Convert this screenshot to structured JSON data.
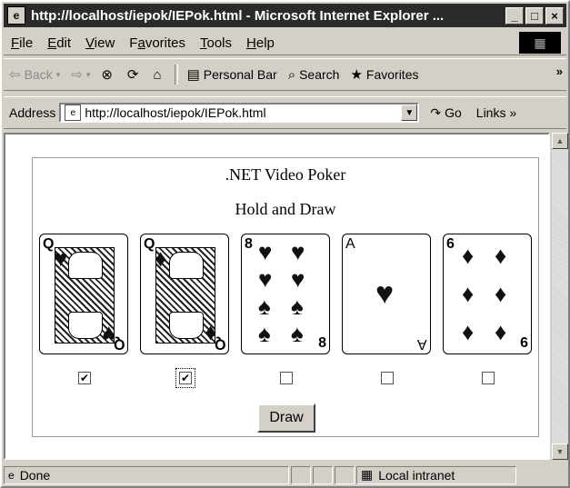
{
  "window": {
    "title": "http://localhost/iepok/IEPok.html - Microsoft Internet Explorer ...",
    "minimize": "_",
    "maximize": "□",
    "close": "×"
  },
  "menu": [
    {
      "pre": "",
      "u": "F",
      "post": "ile"
    },
    {
      "pre": "",
      "u": "E",
      "post": "dit"
    },
    {
      "pre": "",
      "u": "V",
      "post": "iew"
    },
    {
      "pre": "F",
      "u": "a",
      "post": "vorites"
    },
    {
      "pre": "",
      "u": "T",
      "post": "ools"
    },
    {
      "pre": "",
      "u": "H",
      "post": "elp"
    }
  ],
  "toolbar": {
    "back": "Back",
    "personal_bar": "Personal Bar",
    "search": "Search",
    "favorites": "Favorites"
  },
  "address": {
    "label": "Address",
    "url": "http://localhost/iepok/IEPok.html",
    "go": "Go",
    "links": "Links"
  },
  "page": {
    "title": ".NET Video Poker",
    "subtitle": "Hold and Draw",
    "cards": [
      {
        "rank": "Q",
        "suit": "♥",
        "type": "face",
        "held": true
      },
      {
        "rank": "Q",
        "suit": "♦",
        "type": "face",
        "held": true
      },
      {
        "rank": "8",
        "suit": "♥♠",
        "type": "pips",
        "held": false
      },
      {
        "rank": "A",
        "suit": "♥",
        "type": "ace",
        "held": false
      },
      {
        "rank": "6",
        "suit": "♦",
        "type": "pips",
        "held": false
      }
    ],
    "draw_button": "Draw"
  },
  "status": {
    "text": "Done",
    "zone": "Local intranet"
  }
}
